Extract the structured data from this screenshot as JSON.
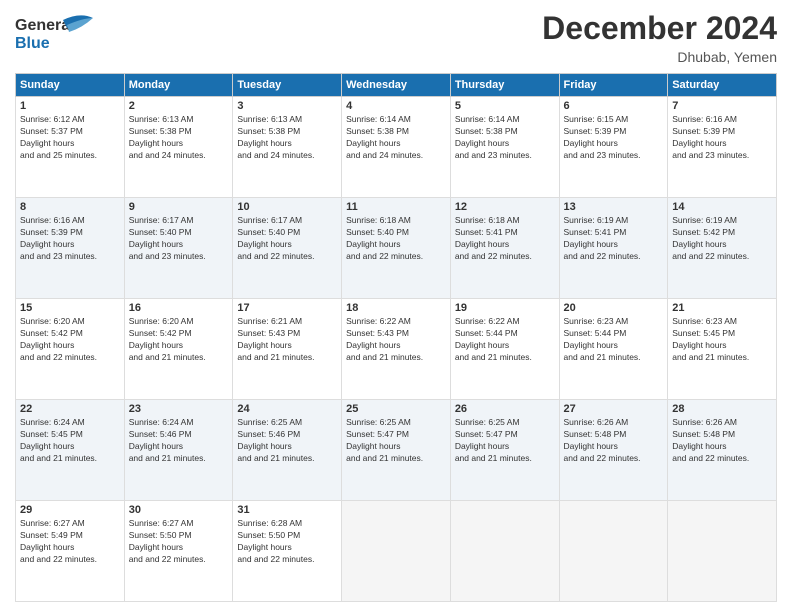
{
  "header": {
    "logo_line1": "General",
    "logo_line2": "Blue",
    "month": "December 2024",
    "location": "Dhubab, Yemen"
  },
  "weekdays": [
    "Sunday",
    "Monday",
    "Tuesday",
    "Wednesday",
    "Thursday",
    "Friday",
    "Saturday"
  ],
  "weeks": [
    [
      {
        "day": "1",
        "sunrise": "6:12 AM",
        "sunset": "5:37 PM",
        "daylight": "11 hours and 25 minutes."
      },
      {
        "day": "2",
        "sunrise": "6:13 AM",
        "sunset": "5:38 PM",
        "daylight": "11 hours and 24 minutes."
      },
      {
        "day": "3",
        "sunrise": "6:13 AM",
        "sunset": "5:38 PM",
        "daylight": "11 hours and 24 minutes."
      },
      {
        "day": "4",
        "sunrise": "6:14 AM",
        "sunset": "5:38 PM",
        "daylight": "11 hours and 24 minutes."
      },
      {
        "day": "5",
        "sunrise": "6:14 AM",
        "sunset": "5:38 PM",
        "daylight": "11 hours and 23 minutes."
      },
      {
        "day": "6",
        "sunrise": "6:15 AM",
        "sunset": "5:39 PM",
        "daylight": "11 hours and 23 minutes."
      },
      {
        "day": "7",
        "sunrise": "6:16 AM",
        "sunset": "5:39 PM",
        "daylight": "11 hours and 23 minutes."
      }
    ],
    [
      {
        "day": "8",
        "sunrise": "6:16 AM",
        "sunset": "5:39 PM",
        "daylight": "11 hours and 23 minutes."
      },
      {
        "day": "9",
        "sunrise": "6:17 AM",
        "sunset": "5:40 PM",
        "daylight": "11 hours and 23 minutes."
      },
      {
        "day": "10",
        "sunrise": "6:17 AM",
        "sunset": "5:40 PM",
        "daylight": "11 hours and 22 minutes."
      },
      {
        "day": "11",
        "sunrise": "6:18 AM",
        "sunset": "5:40 PM",
        "daylight": "11 hours and 22 minutes."
      },
      {
        "day": "12",
        "sunrise": "6:18 AM",
        "sunset": "5:41 PM",
        "daylight": "11 hours and 22 minutes."
      },
      {
        "day": "13",
        "sunrise": "6:19 AM",
        "sunset": "5:41 PM",
        "daylight": "11 hours and 22 minutes."
      },
      {
        "day": "14",
        "sunrise": "6:19 AM",
        "sunset": "5:42 PM",
        "daylight": "11 hours and 22 minutes."
      }
    ],
    [
      {
        "day": "15",
        "sunrise": "6:20 AM",
        "sunset": "5:42 PM",
        "daylight": "11 hours and 22 minutes."
      },
      {
        "day": "16",
        "sunrise": "6:20 AM",
        "sunset": "5:42 PM",
        "daylight": "11 hours and 21 minutes."
      },
      {
        "day": "17",
        "sunrise": "6:21 AM",
        "sunset": "5:43 PM",
        "daylight": "11 hours and 21 minutes."
      },
      {
        "day": "18",
        "sunrise": "6:22 AM",
        "sunset": "5:43 PM",
        "daylight": "11 hours and 21 minutes."
      },
      {
        "day": "19",
        "sunrise": "6:22 AM",
        "sunset": "5:44 PM",
        "daylight": "11 hours and 21 minutes."
      },
      {
        "day": "20",
        "sunrise": "6:23 AM",
        "sunset": "5:44 PM",
        "daylight": "11 hours and 21 minutes."
      },
      {
        "day": "21",
        "sunrise": "6:23 AM",
        "sunset": "5:45 PM",
        "daylight": "11 hours and 21 minutes."
      }
    ],
    [
      {
        "day": "22",
        "sunrise": "6:24 AM",
        "sunset": "5:45 PM",
        "daylight": "11 hours and 21 minutes."
      },
      {
        "day": "23",
        "sunrise": "6:24 AM",
        "sunset": "5:46 PM",
        "daylight": "11 hours and 21 minutes."
      },
      {
        "day": "24",
        "sunrise": "6:25 AM",
        "sunset": "5:46 PM",
        "daylight": "11 hours and 21 minutes."
      },
      {
        "day": "25",
        "sunrise": "6:25 AM",
        "sunset": "5:47 PM",
        "daylight": "11 hours and 21 minutes."
      },
      {
        "day": "26",
        "sunrise": "6:25 AM",
        "sunset": "5:47 PM",
        "daylight": "11 hours and 21 minutes."
      },
      {
        "day": "27",
        "sunrise": "6:26 AM",
        "sunset": "5:48 PM",
        "daylight": "11 hours and 22 minutes."
      },
      {
        "day": "28",
        "sunrise": "6:26 AM",
        "sunset": "5:48 PM",
        "daylight": "11 hours and 22 minutes."
      }
    ],
    [
      {
        "day": "29",
        "sunrise": "6:27 AM",
        "sunset": "5:49 PM",
        "daylight": "11 hours and 22 minutes."
      },
      {
        "day": "30",
        "sunrise": "6:27 AM",
        "sunset": "5:50 PM",
        "daylight": "11 hours and 22 minutes."
      },
      {
        "day": "31",
        "sunrise": "6:28 AM",
        "sunset": "5:50 PM",
        "daylight": "11 hours and 22 minutes."
      },
      null,
      null,
      null,
      null
    ]
  ],
  "labels": {
    "sunrise": "Sunrise:",
    "sunset": "Sunset:",
    "daylight": "Daylight:"
  }
}
